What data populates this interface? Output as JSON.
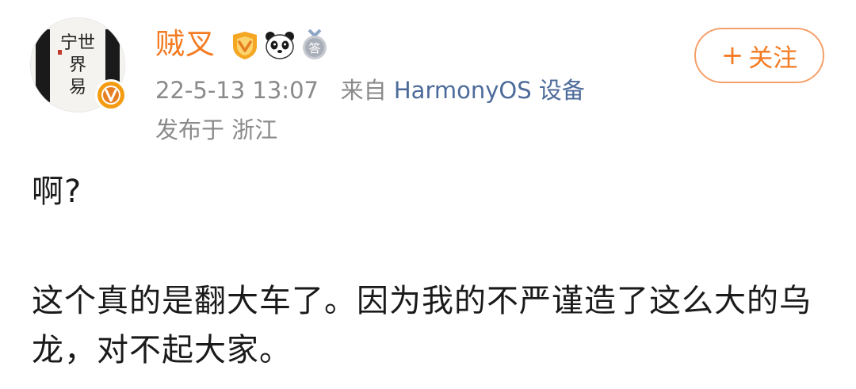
{
  "post": {
    "username": "贼叉",
    "badges": [
      "vip-shield-icon",
      "panda-icon",
      "answer-badge-icon"
    ],
    "badge_answer_char": "答",
    "timestamp": "22-5-13 13:07",
    "source_prefix": "来自",
    "source": "HarmonyOS 设备",
    "location_prefix": "发布于",
    "location": "浙江",
    "follow_label": "关注",
    "follow_plus": "+",
    "paragraphs": [
      "啊?",
      "这个真的是翻大车了。因为我的不严谨造了这么大的乌龙，对不起大家。"
    ],
    "avatar_calligraphy": "宁世界易",
    "verified_letter": "V",
    "colors": {
      "accent": "#f47b21",
      "link": "#4d6b9a",
      "meta": "#8a8a8a",
      "verified": "#f39c12"
    }
  }
}
